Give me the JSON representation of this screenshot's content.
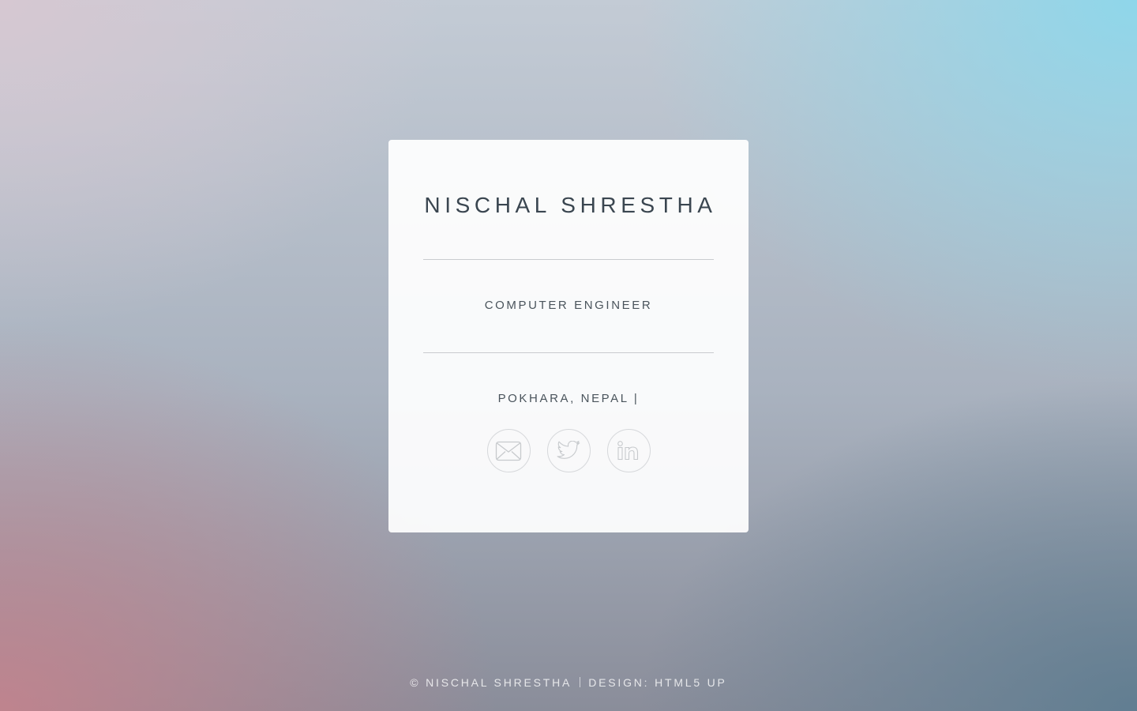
{
  "profile": {
    "name": "NISCHAL SHRESTHA",
    "role": "COMPUTER ENGINEER",
    "location": "POKHARA, NEPAL |"
  },
  "social": [
    {
      "icon": "envelope-icon",
      "label": "Email"
    },
    {
      "icon": "twitter-icon",
      "label": "Twitter"
    },
    {
      "icon": "linkedin-icon",
      "label": "LinkedIn"
    }
  ],
  "footer": {
    "copyright": "© NISCHAL SHRESTHA",
    "design_prefix": "DESIGN: ",
    "design_link": "HTML5 UP"
  },
  "colors": {
    "card_background": "#ffffff",
    "heading_text": "#3a4650",
    "body_text": "#4a545c",
    "icon_stroke": "#c7cacd"
  }
}
